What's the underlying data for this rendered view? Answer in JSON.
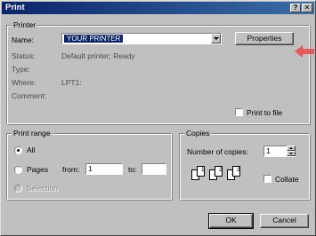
{
  "window": {
    "title": "Print",
    "help_glyph": "?",
    "close_glyph": "✕"
  },
  "printer": {
    "group_label": "Printer",
    "name_label": "Name:",
    "name_value": "YOUR PRINTER",
    "properties_label": "Properties",
    "status_label": "Status:",
    "status_value": "Default printer; Ready",
    "type_label": "Type:",
    "type_value": "",
    "where_label": "Where:",
    "where_value": "LPT1:",
    "comment_label": "Comment:",
    "comment_value": "",
    "print_to_file_label": "Print to file",
    "print_to_file_checked": false
  },
  "print_range": {
    "group_label": "Print range",
    "all_label": "All",
    "pages_label": "Pages",
    "from_label": "from:",
    "from_value": "1",
    "to_label": "to:",
    "to_value": "",
    "selection_label": "Selection",
    "selected": "All"
  },
  "copies": {
    "group_label": "Copies",
    "number_label": "Number of copies:",
    "number_value": "1",
    "collate_label": "Collate",
    "collate_checked": false,
    "collate_pages": [
      "1",
      "1",
      "2",
      "2",
      "3",
      "3"
    ]
  },
  "buttons": {
    "ok": "OK",
    "cancel": "Cancel"
  },
  "annotation": {
    "arrow_color": "#e8585a",
    "arrow_icon": "left-arrow-icon"
  },
  "colors": {
    "title_bar": "#0a246a",
    "selection_highlight": "#0a246a",
    "dialog_face": "#c0c0c0"
  }
}
